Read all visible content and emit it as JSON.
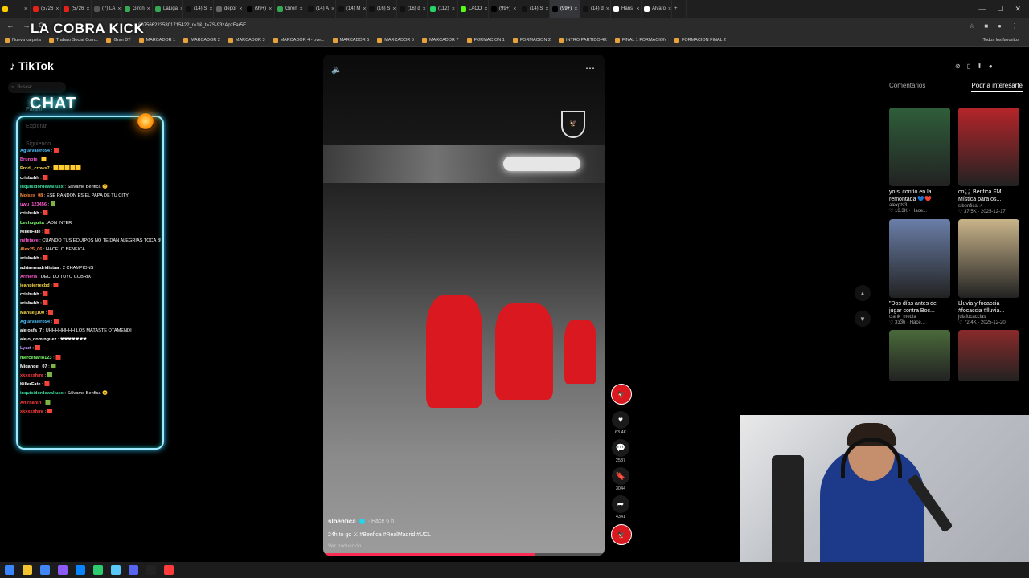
{
  "browser": {
    "tabs": [
      {
        "label": "",
        "color": "#ffcc00"
      },
      {
        "label": "(5726",
        "color": "#e62117"
      },
      {
        "label": "(5726",
        "color": "#e62117"
      },
      {
        "label": "(7) LA",
        "color": "#555555"
      },
      {
        "label": "Giron",
        "color": "#34a853"
      },
      {
        "label": "LaLiga",
        "color": "#34a853"
      },
      {
        "label": "(14) S",
        "color": "#111111"
      },
      {
        "label": "depor",
        "color": "#666666"
      },
      {
        "label": "(99+)",
        "color": "#000000"
      },
      {
        "label": "Giron",
        "color": "#34a853"
      },
      {
        "label": "(14) A",
        "color": "#111111"
      },
      {
        "label": "(14) M",
        "color": "#111111"
      },
      {
        "label": "(16) S",
        "color": "#111111"
      },
      {
        "label": "(16) d",
        "color": "#111111"
      },
      {
        "label": "(112)",
        "color": "#25d366"
      },
      {
        "label": "LACO",
        "color": "#53fc18"
      },
      {
        "label": "(99+)",
        "color": "#000000"
      },
      {
        "label": "(14) S",
        "color": "#111111"
      },
      {
        "label": "(99+)",
        "color": "#000000"
      },
      {
        "label": "(14) d",
        "color": "#111111"
      },
      {
        "label": "Hansi",
        "color": "#ffffff"
      },
      {
        "label": "Álvaro",
        "color": "#ffffff"
      }
    ],
    "active_tab_index": 18,
    "url": "607566223580171542?_r=1&_t=ZS-93zApzFar5E",
    "bookmarks": [
      "Nueva carpeta",
      "Trabajo Social Com...",
      "Gran DT",
      "MARCADOR 1",
      "MARCADOR 2",
      "MARCADOR 3",
      "MARCADOR 4 - ove...",
      "MARCADOR 5",
      "MARCADOR 6",
      "MARCADOR 7",
      "FORMACION 1",
      "FORMACION 2",
      "INTRO PARTIDO 4K",
      "FINAL 1 FORMACION",
      "FORMACION FINAL 2"
    ],
    "bookmarks_right": "Todos los favoritos"
  },
  "overlay": {
    "brand": "LA COBRA KICK",
    "chat_title": "CHAT"
  },
  "tiktok": {
    "logo": "TikTok",
    "search_placeholder": "Buscar",
    "side_items": [
      "Para ti",
      "Explorar",
      "Siguiendo"
    ]
  },
  "chat": {
    "messages": [
      {
        "user": "AguaValero94",
        "text": ": 🟥",
        "color": "#4fc3ff"
      },
      {
        "user": "Brunote",
        "text": ": 🟨",
        "color": "#ff5bd0"
      },
      {
        "user": "Prodi_crows7",
        "text": ": 🟨🟨🟨🟨🟨",
        "color": "#f6d84a"
      },
      {
        "user": "crisbuhh",
        "text": ": 🟥",
        "color": "#ffffff"
      },
      {
        "user": "inquisidordewallusx",
        "text": ": Sálvame Benfica 😊",
        "color": "#3fe0a0"
      },
      {
        "user": "Moises_08",
        "text": ": ESE RANDON ES EL PAPA DE TU CITY",
        "color": "#ff8a3d"
      },
      {
        "user": "uwu_123456",
        "text": ": 🟩",
        "color": "#ff5bd0"
      },
      {
        "user": "crisbuhh",
        "text": ": 🟥",
        "color": "#ffffff"
      },
      {
        "user": "Lechuguita",
        "text": ": ADN INTER",
        "color": "#7dff6a"
      },
      {
        "user": "KillerFate",
        "text": ": 🟥",
        "color": "#ffffff"
      },
      {
        "user": "mifetave",
        "text": ": CUANDO TUS EQUIPOS NO TE DAN ALEGRIAS TOCA BUSCAR OTROS COMO SIEMPRE LO HACE EL NINE",
        "color": "#ff5bd0"
      },
      {
        "user": "Alex25_06",
        "text": ": HACELO BENFICA",
        "color": "#ff8a3d"
      },
      {
        "user": "crisbuhh",
        "text": ": 🟥",
        "color": "#ffffff"
      },
      {
        "user": "adrianmadridistaa",
        "text": ": 2 CHAMPIONS",
        "color": "#ffffff"
      },
      {
        "user": "Armeria",
        "text": ": DECI LO TUYO COBRIX",
        "color": "#ff5bd0"
      },
      {
        "user": "jeanpierrecbd",
        "text": ": 🟥",
        "color": "#f6d84a"
      },
      {
        "user": "crisbuhh",
        "text": ": 🟥",
        "color": "#ffffff"
      },
      {
        "user": "crisbuhh",
        "text": ": 🟥",
        "color": "#ffffff"
      },
      {
        "user": "Manuelj100",
        "text": ": 🟥",
        "color": "#f6d84a"
      },
      {
        "user": "AguaValero94",
        "text": ": 🟥",
        "color": "#4fc3ff"
      },
      {
        "user": "alejosfa_7",
        "text": ": UHHHHHHHH LOS MATASTE OTAMENDI",
        "color": "#ffffff"
      },
      {
        "user": "alejo_dominguez",
        "text": ": ❤❤❤❤❤❤❤",
        "color": "#ffffff"
      },
      {
        "user": "Lyzzt",
        "text": ": 🟥",
        "color": "#c39bff"
      },
      {
        "user": "mercenario123",
        "text": ": 🟥",
        "color": "#7dff6a"
      },
      {
        "user": "Migangel_07",
        "text": ": 🟩",
        "color": "#ffffff"
      },
      {
        "user": "xkxxxxhmr",
        "text": ": 🟩",
        "color": "#ff3b3b"
      },
      {
        "user": "KillerFate",
        "text": ": 🟥",
        "color": "#ffffff"
      },
      {
        "user": "inquisidordewallusx",
        "text": ": Sálvame Benfica 😊",
        "color": "#3fe0a0"
      },
      {
        "user": "Ahirnahiri",
        "text": ": 🟩",
        "color": "#ff3b3b"
      },
      {
        "user": "xkxxxxhmr",
        "text": ": 🟥",
        "color": "#ff3b3b"
      }
    ]
  },
  "video": {
    "author": "slbenfica",
    "time": "· Hace 6 h",
    "caption": "24h to go ⚔ #Benfica #RealMadrid #UCL",
    "translate": "Ver traducción",
    "volume_icon": "speaker-icon",
    "progress": 0.75,
    "actions": [
      {
        "name": "like",
        "icon": "♥",
        "count": "63.4K"
      },
      {
        "name": "comment",
        "icon": "💬",
        "count": "2537"
      },
      {
        "name": "save",
        "icon": "🔖",
        "count": "3044"
      },
      {
        "name": "share",
        "icon": "➦",
        "count": "4341"
      }
    ]
  },
  "right_panel": {
    "tabs": [
      "Comentarios",
      "Podría interesarte"
    ],
    "active_tab": 1,
    "cards": [
      {
        "title": "yo si confío en la remontada 💙❤️",
        "author": "alexpts3",
        "meta": "♡ 16.3K · Hace...",
        "color": "#2f5e3a"
      },
      {
        "title": "co🎧 Benfica FM. Mística para os...",
        "author": "slbenfica ✓",
        "meta": "♡ 37.5K · 2025-12-17",
        "color": "#b5252a"
      },
      {
        "title": "\"Dos días antes de jugar contra Boc...",
        "author": "clank_media",
        "meta": "♡ 3336 · Hace...",
        "color": "#6a7ea8"
      },
      {
        "title": "Lluvia y focaccia #focaccia #lluvia...",
        "author": "julafocaccias",
        "meta": "♡ 72.4K · 2025-12-20",
        "color": "#c9b48a"
      },
      {
        "title": "",
        "author": "",
        "meta": "",
        "color": "#4a6a3a"
      },
      {
        "title": "",
        "author": "",
        "meta": "",
        "color": "#8a2a2a"
      }
    ]
  },
  "taskbar": {
    "icons": [
      "windows-icon",
      "explorer-icon",
      "chrome-icon",
      "app-icon",
      "edge-icon",
      "app2-icon",
      "notes-icon",
      "discord-icon",
      "obs-icon",
      "app3-icon"
    ]
  }
}
